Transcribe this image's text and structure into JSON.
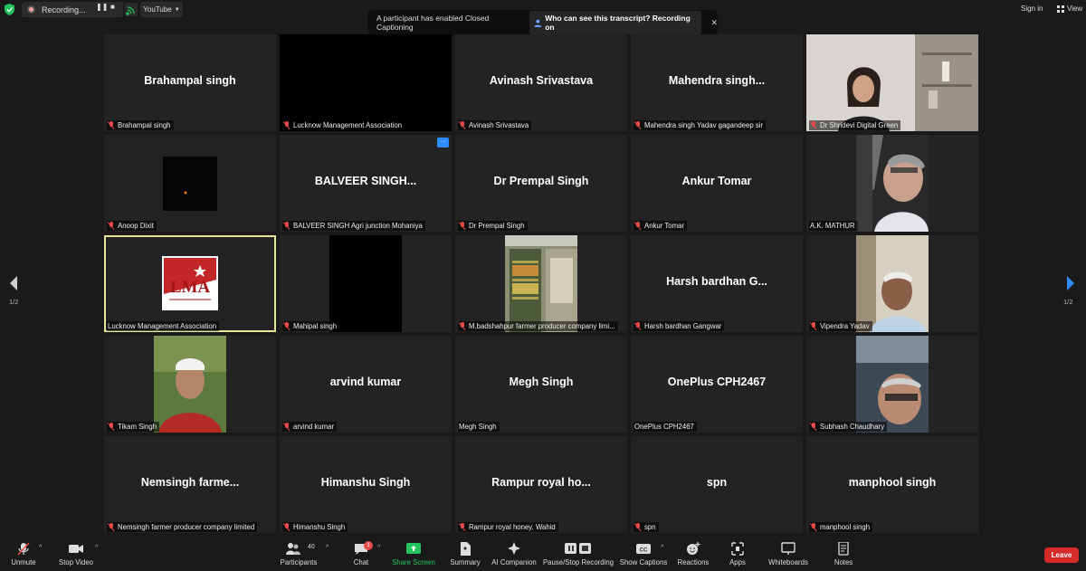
{
  "topbar": {
    "recording_label": "Recording...",
    "stream_label": "YouTube",
    "signin_label": "Sign in",
    "view_label": "View"
  },
  "banner": {
    "message": "A participant has enabled Closed Captioning",
    "link_label": "Who can see this transcript? Recording on"
  },
  "tiles": [
    {
      "center": "Brahampal singh",
      "label": "Brahampal singh",
      "muted": true
    },
    {
      "center": "",
      "label": "Lucknow Management Association",
      "muted": true
    },
    {
      "center": "Avinash Srivastava",
      "label": "Avinash Srivastava",
      "muted": true
    },
    {
      "center": "Mahendra  singh...",
      "label": "Mahendra singh Yadav gagandeep sir",
      "muted": true
    },
    {
      "center": "",
      "label": "Dr Shridevi Digital Green",
      "muted": true
    },
    {
      "center": "",
      "label": "Anoop Dixit",
      "muted": true
    },
    {
      "center": "BALVEER  SINGH...",
      "label": "BALVEER SINGH Agri junction Mohaniya",
      "muted": true
    },
    {
      "center": "Dr Prempal Singh",
      "label": "Dr Prempal Singh",
      "muted": true
    },
    {
      "center": "Ankur Tomar",
      "label": "Ankur Tomar",
      "muted": true
    },
    {
      "center": "",
      "label": "A.K. MATHUR",
      "muted": false
    },
    {
      "center": "",
      "label": "Lucknow Management Association",
      "muted": false
    },
    {
      "center": "",
      "label": "Mahipal singh",
      "muted": true
    },
    {
      "center": "",
      "label": "M.badshahpur farmer producer company limi...",
      "muted": true
    },
    {
      "center": "Harsh bardhan G...",
      "label": "Harsh bardhan Gangwar",
      "muted": true
    },
    {
      "center": "",
      "label": "Vipendra Yadav",
      "muted": true
    },
    {
      "center": "",
      "label": "Tikam Singh",
      "muted": true
    },
    {
      "center": "arvind kumar",
      "label": "arvind kumar",
      "muted": true
    },
    {
      "center": "Megh Singh",
      "label": "Megh Singh",
      "muted": false
    },
    {
      "center": "OnePlus CPH2467",
      "label": "OnePlus CPH2467",
      "muted": false
    },
    {
      "center": "",
      "label": "Subhash Chaudhary",
      "muted": true
    },
    {
      "center": "Nemsingh  farme...",
      "label": "Nemsingh farmer producer company limited",
      "muted": true
    },
    {
      "center": "Himanshu Singh",
      "label": "Himanshu Singh",
      "muted": true
    },
    {
      "center": "Rampur  royal  ho...",
      "label": "Rampur royal honey. Wahid",
      "muted": true
    },
    {
      "center": "spn",
      "label": "spn",
      "muted": true
    },
    {
      "center": "manphool singh",
      "label": "manphool singh",
      "muted": true
    }
  ],
  "logo_text": "LMA",
  "pagination": {
    "left": "1/2",
    "right": "1/2"
  },
  "toolbar": {
    "unmute": "Unmute",
    "stop_video": "Stop Video",
    "participants": "Participants",
    "participants_count": "40",
    "chat": "Chat",
    "chat_badge": "1",
    "share_screen": "Share Screen",
    "summary": "Summary",
    "ai_companion": "AI Companion",
    "pause_stop_recording": "Pause/Stop Recording",
    "show_captions": "Show Captions",
    "reactions": "Reactions",
    "apps": "Apps",
    "whiteboards": "Whiteboards",
    "notes": "Notes",
    "leave": "Leave"
  },
  "colors": {
    "share_green": "#23c45e",
    "leave_red": "#d62b2b",
    "active_outline": "#e6e69a",
    "mute_red": "#e84a4a"
  }
}
